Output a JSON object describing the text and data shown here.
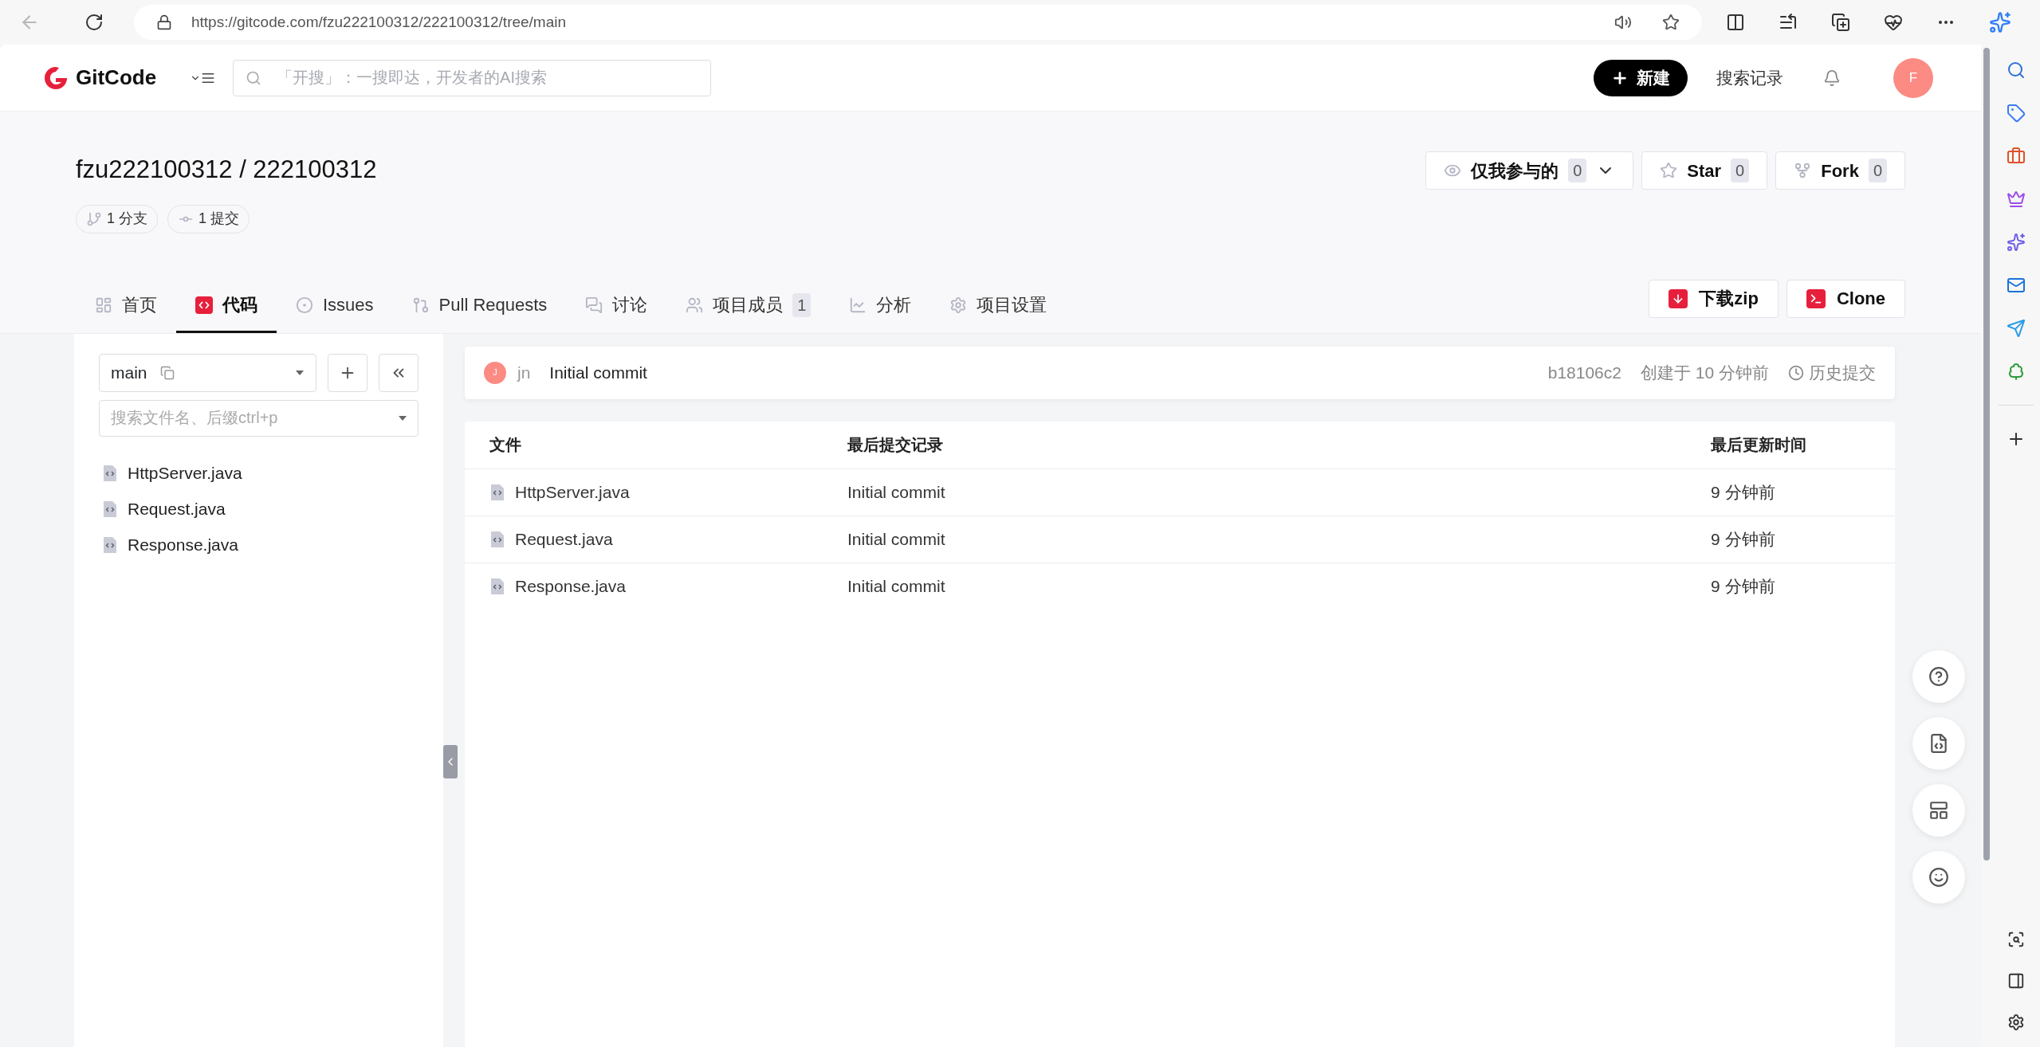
{
  "browser": {
    "url": "https://gitcode.com/fzu222100312/222100312/tree/main"
  },
  "header": {
    "logo": "GitCode",
    "search_placeholder": "「开搜」：一搜即达，开发者的AI搜索",
    "new_button": "新建",
    "search_history": "搜索记录",
    "avatar": "F"
  },
  "repo": {
    "title": "fzu222100312 / 222100312",
    "stats": [
      {
        "kind": "branch",
        "label": "1 分支"
      },
      {
        "kind": "commit",
        "label": "1 提交"
      }
    ],
    "actions": [
      {
        "kind": "watch",
        "label": "仅我参与的",
        "count": "0"
      },
      {
        "kind": "star",
        "label": "Star",
        "count": "0"
      },
      {
        "kind": "fork",
        "label": "Fork",
        "count": "0"
      }
    ]
  },
  "tabs": [
    {
      "kind": "home",
      "label": "首页",
      "selected": false
    },
    {
      "kind": "code",
      "label": "代码",
      "selected": true
    },
    {
      "kind": "issues",
      "label": "Issues",
      "selected": false
    },
    {
      "kind": "pulls",
      "label": "Pull Requests",
      "selected": false
    },
    {
      "kind": "discuss",
      "label": "讨论",
      "selected": false
    },
    {
      "kind": "members",
      "label": "项目成员",
      "count": "1",
      "selected": false
    },
    {
      "kind": "analysis",
      "label": "分析",
      "selected": false
    },
    {
      "kind": "settings",
      "label": "项目设置",
      "selected": false
    }
  ],
  "tab_actions": [
    {
      "kind": "download",
      "label": "下载zip"
    },
    {
      "kind": "clone",
      "label": "Clone"
    }
  ],
  "sidebar": {
    "branch": "main",
    "file_search_placeholder": "搜索文件名、后缀ctrl+p",
    "files": [
      "HttpServer.java",
      "Request.java",
      "Response.java"
    ]
  },
  "commit": {
    "avatar": "J",
    "author": "jn",
    "message": "Initial commit",
    "sha": "b18106c2",
    "created": "创建于 10 分钟前",
    "history": "历史提交"
  },
  "table": {
    "columns": [
      "文件",
      "最后提交记录",
      "最后更新时间"
    ],
    "rows": [
      {
        "name": "HttpServer.java",
        "commit": "Initial commit",
        "time": "9 分钟前"
      },
      {
        "name": "Request.java",
        "commit": "Initial commit",
        "time": "9 分钟前"
      },
      {
        "name": "Response.java",
        "commit": "Initial commit",
        "time": "9 分钟前"
      }
    ]
  }
}
